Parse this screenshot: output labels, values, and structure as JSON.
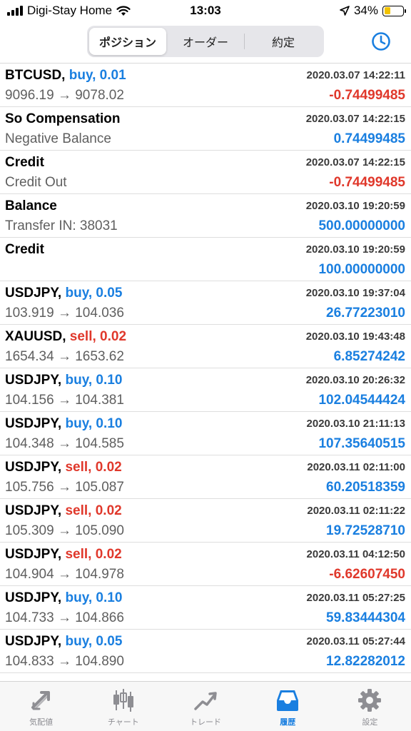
{
  "status_bar": {
    "carrier": "Digi-Stay Home",
    "time": "13:03",
    "battery_percent": "34%",
    "battery_level": 0.34
  },
  "header": {
    "tabs": [
      {
        "label": "ポジション",
        "active": true
      },
      {
        "label": "オーダー",
        "active": false
      },
      {
        "label": "約定",
        "active": false
      }
    ]
  },
  "colors": {
    "buy": "#1a7fe0",
    "sell": "#e0382b",
    "accent": "#1a7fe0"
  },
  "rows": [
    {
      "symbol": "BTCUSD,",
      "dir": "buy, 0.01",
      "dir_type": "buy",
      "datetime": "2020.03.07 14:22:11",
      "detail": "9096.19 → 9078.02",
      "profit": "-0.74499485",
      "profit_sign": "neg"
    },
    {
      "symbol": "So Compensation",
      "dir": "",
      "dir_type": "",
      "datetime": "2020.03.07 14:22:15",
      "detail": "Negative Balance",
      "profit": "0.74499485",
      "profit_sign": "pos"
    },
    {
      "symbol": "Credit",
      "dir": "",
      "dir_type": "",
      "datetime": "2020.03.07 14:22:15",
      "detail": "Credit Out",
      "profit": "-0.74499485",
      "profit_sign": "neg"
    },
    {
      "symbol": "Balance",
      "dir": "",
      "dir_type": "",
      "datetime": "2020.03.10 19:20:59",
      "detail": "Transfer IN: 38031",
      "profit": "500.00000000",
      "profit_sign": "pos"
    },
    {
      "symbol": "Credit",
      "dir": "",
      "dir_type": "",
      "datetime": "2020.03.10 19:20:59",
      "detail": "",
      "profit": "100.00000000",
      "profit_sign": "pos"
    },
    {
      "symbol": "USDJPY,",
      "dir": "buy, 0.05",
      "dir_type": "buy",
      "datetime": "2020.03.10 19:37:04",
      "detail": "103.919 → 104.036",
      "profit": "26.77223010",
      "profit_sign": "pos"
    },
    {
      "symbol": "XAUUSD,",
      "dir": "sell, 0.02",
      "dir_type": "sell",
      "datetime": "2020.03.10 19:43:48",
      "detail": "1654.34 → 1653.62",
      "profit": "6.85274242",
      "profit_sign": "pos"
    },
    {
      "symbol": "USDJPY,",
      "dir": "buy, 0.10",
      "dir_type": "buy",
      "datetime": "2020.03.10 20:26:32",
      "detail": "104.156 → 104.381",
      "profit": "102.04544424",
      "profit_sign": "pos"
    },
    {
      "symbol": "USDJPY,",
      "dir": "buy, 0.10",
      "dir_type": "buy",
      "datetime": "2020.03.10 21:11:13",
      "detail": "104.348 → 104.585",
      "profit": "107.35640515",
      "profit_sign": "pos"
    },
    {
      "symbol": "USDJPY,",
      "dir": "sell, 0.02",
      "dir_type": "sell",
      "datetime": "2020.03.11 02:11:00",
      "detail": "105.756 → 105.087",
      "profit": "60.20518359",
      "profit_sign": "pos"
    },
    {
      "symbol": "USDJPY,",
      "dir": "sell, 0.02",
      "dir_type": "sell",
      "datetime": "2020.03.11 02:11:22",
      "detail": "105.309 → 105.090",
      "profit": "19.72528710",
      "profit_sign": "pos"
    },
    {
      "symbol": "USDJPY,",
      "dir": "sell, 0.02",
      "dir_type": "sell",
      "datetime": "2020.03.11 04:12:50",
      "detail": "104.904 → 104.978",
      "profit": "-6.62607450",
      "profit_sign": "neg"
    },
    {
      "symbol": "USDJPY,",
      "dir": "buy, 0.10",
      "dir_type": "buy",
      "datetime": "2020.03.11 05:27:25",
      "detail": "104.733 → 104.866",
      "profit": "59.83444304",
      "profit_sign": "pos"
    },
    {
      "symbol": "USDJPY,",
      "dir": "buy, 0.05",
      "dir_type": "buy",
      "datetime": "2020.03.11 05:27:44",
      "detail": "104.833 → 104.890",
      "profit": "12.82282012",
      "profit_sign": "pos"
    }
  ],
  "tabbar": {
    "tabs": [
      {
        "label": "気配値",
        "icon": "quotes-icon",
        "active": false
      },
      {
        "label": "チャート",
        "icon": "chart-icon",
        "active": false
      },
      {
        "label": "トレード",
        "icon": "trade-icon",
        "active": false
      },
      {
        "label": "履歴",
        "icon": "history-icon",
        "active": true
      },
      {
        "label": "設定",
        "icon": "gear-icon",
        "active": false
      }
    ]
  }
}
